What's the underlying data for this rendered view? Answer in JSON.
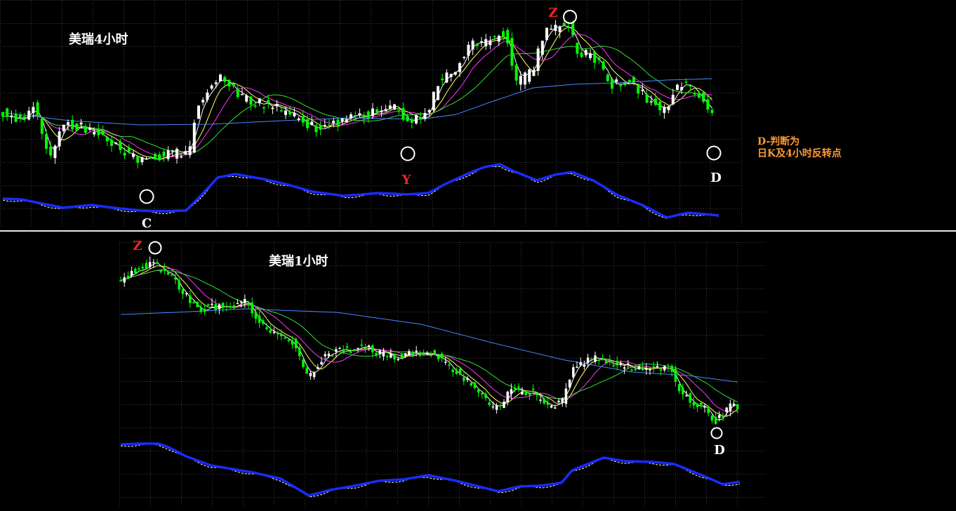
{
  "colors": {
    "background": "#000000",
    "grid": "#3a3a3a",
    "separator": "#e6e6e6",
    "candle_bull": "#ffffff",
    "candle_bear": "#00ff00",
    "ma_fast": "#ffffff",
    "ma_2": "#ffff66",
    "ma_3": "#ff33ff",
    "ma_4": "#33dd33",
    "ma_slow": "#4488ff",
    "indicator_main": "#1a2bff",
    "indicator_signal": "#ffffff",
    "title_text": "#ffffff",
    "marker_red": "#ff2020",
    "marker_white": "#ffffff",
    "note_text": "#ff9933"
  },
  "panels": {
    "top": {
      "title": "美瑞4小时",
      "markers": {
        "c": "C",
        "y": "Y",
        "z": "Z",
        "d": "D"
      },
      "note_line1": "D-判断为",
      "note_line2": "日K及4小时反转点"
    },
    "bottom": {
      "title": "美瑞1小时",
      "markers": {
        "z": "Z",
        "d": "D"
      }
    }
  },
  "chart_data": [
    {
      "type": "candlestick",
      "title": "美瑞4小时",
      "series": [
        "candles",
        "moving-average x5",
        "oscillator (main + signal)"
      ],
      "annotations": [
        "C",
        "Y",
        "Z",
        "D",
        "D-判断为 日K及4小时反转点"
      ],
      "grid": true
    },
    {
      "type": "candlestick",
      "title": "美瑞1小时",
      "series": [
        "candles",
        "moving-average x5",
        "oscillator (main + signal)"
      ],
      "annotations": [
        "Z",
        "D"
      ],
      "grid": true
    }
  ]
}
